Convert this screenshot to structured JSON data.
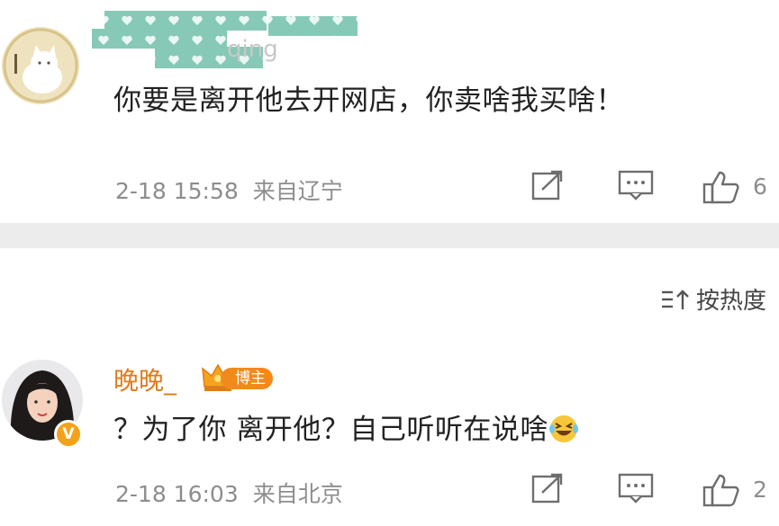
{
  "comments": [
    {
      "username_visible_fragment": "qing",
      "username_blurred": true,
      "text": "你要是离开他去开网店，你卖啥我买啥！",
      "time": "2-18 15:58",
      "source": "来自辽宁",
      "likes": "6"
    },
    {
      "username": "晚晚_",
      "badge": "博主",
      "verified_badge": "V",
      "text": "？为了你 离开他？自己听听在说啥",
      "emoji": "laughing-tears-emoji",
      "time": "2-18 16:03",
      "source": "来自北京",
      "likes": "2"
    }
  ],
  "sort": {
    "label": "按热度"
  },
  "colors": {
    "username": "#e07b19",
    "badge": "#f28a1b",
    "meta": "#8d8d8d",
    "divider": "#ececec"
  }
}
